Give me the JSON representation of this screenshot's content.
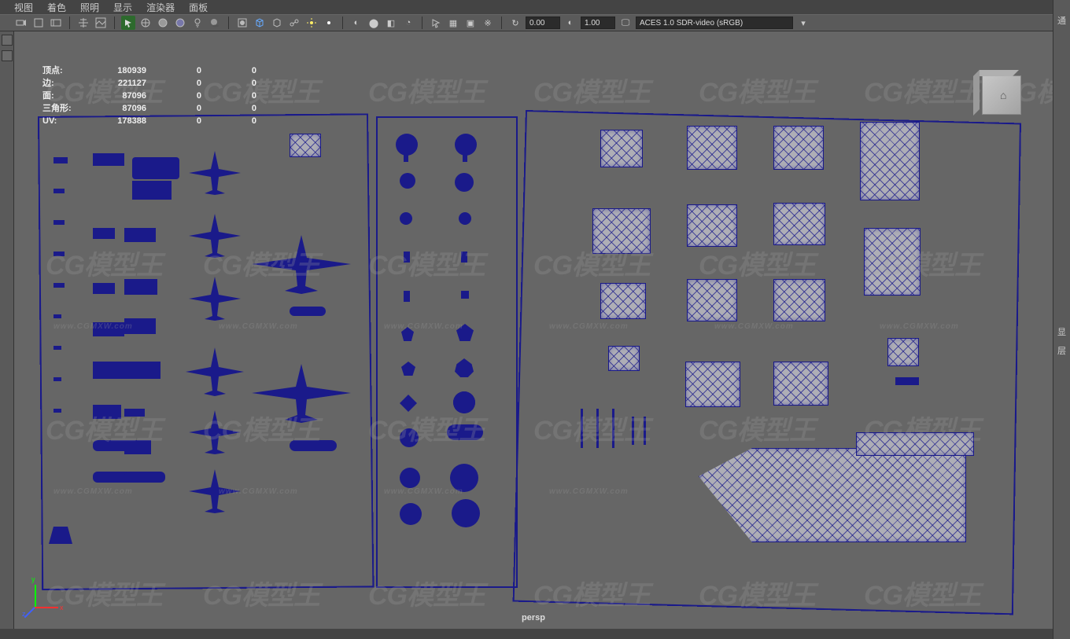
{
  "panel_menu": {
    "view": "视图",
    "shading": "着色",
    "lighting": "照明",
    "show": "显示",
    "renderer": "渲染器",
    "panels": "面板"
  },
  "toolbar": {
    "exposure": "0.00",
    "gamma": "1.00",
    "colorspace": "ACES 1.0 SDR-video (sRGB)"
  },
  "hud": {
    "rows": [
      {
        "label": "顶点:",
        "v1": "180939",
        "v2": "0",
        "v3": "0"
      },
      {
        "label": "边:",
        "v1": "221127",
        "v2": "0",
        "v3": "0"
      },
      {
        "label": "面:",
        "v1": "87096",
        "v2": "0",
        "v3": "0"
      },
      {
        "label": "三角形:",
        "v1": "87096",
        "v2": "0",
        "v3": "0"
      },
      {
        "label": "UV:",
        "v1": "178388",
        "v2": "0",
        "v3": "0"
      }
    ]
  },
  "camera_label": "persp",
  "right_sidebar": {
    "channel": "通",
    "display": "显",
    "layer": "层"
  },
  "axis": {
    "x": "x",
    "y": "y",
    "z": "z"
  },
  "watermark": {
    "big": "CG模型王",
    "small": "www.CGMXW.com"
  }
}
